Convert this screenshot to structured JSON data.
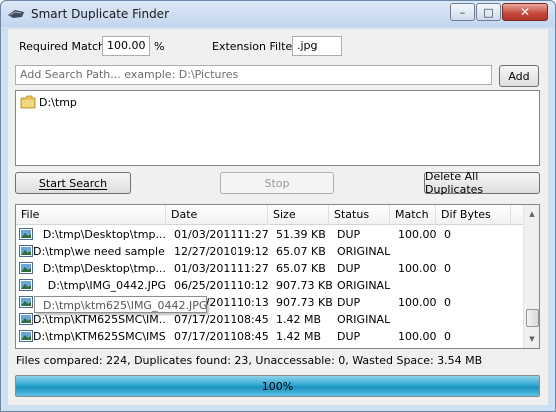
{
  "window": {
    "title": "Smart Duplicate Finder",
    "minimize_glyph": "–",
    "maximize_glyph": "□",
    "close_glyph": "✕"
  },
  "options": {
    "required_match_label": "Required Match:",
    "required_match_value": "100.00",
    "required_match_unit": "%",
    "extension_filter_label": "Extension Filter:",
    "extension_filter_value": ".jpg"
  },
  "search_path": {
    "placeholder": "Add Search Path... example: D:\\Pictures",
    "add_label": "Add"
  },
  "paths": [
    "D:\\tmp"
  ],
  "actions": {
    "start_search": "Start Search",
    "stop": "Stop",
    "delete_all": "Delete All Duplicates"
  },
  "table": {
    "columns": [
      "File",
      "Date",
      "Size",
      "Status",
      "Match",
      "Dif Bytes"
    ],
    "rows": [
      {
        "file": "D:\\tmp\\Desktop\\tmp...",
        "date": "01/03/2011",
        "time": "11:27",
        "size": "51.39 KB",
        "status": "DUP",
        "match": "100.00",
        "dif": "0"
      },
      {
        "file": "D:\\tmp\\we need sample...",
        "date": "12/27/2010",
        "time": "19:12",
        "size": "65.07 KB",
        "status": "ORIGINAL",
        "match": "",
        "dif": ""
      },
      {
        "file": "D:\\tmp\\Desktop\\tmp...",
        "date": "01/03/2011",
        "time": "11:27",
        "size": "65.07 KB",
        "status": "DUP",
        "match": "100.00",
        "dif": "0"
      },
      {
        "file": "D:\\tmp\\IMG_0442.JPG",
        "date": "06/25/2011",
        "time": "10:12",
        "size": "907.73 KB",
        "status": "ORIGINAL",
        "match": "",
        "dif": ""
      },
      {
        "file": "D:\\tmp\\ktm625\\IMG_0442.JPG",
        "date": "06/25/2011",
        "time": "10:13",
        "size": "907.73 KB",
        "status": "DUP",
        "match": "100.00",
        "dif": "0"
      },
      {
        "file": "D:\\tmp\\KTM625SMC\\IM...",
        "date": "07/17/2011",
        "time": "08:45",
        "size": "1.42 MB",
        "status": "ORIGINAL",
        "match": "",
        "dif": ""
      },
      {
        "file": "D:\\tmp\\KTM625SMC\\IMS...",
        "date": "07/17/2011",
        "time": "08:45",
        "size": "1.42 MB",
        "status": "DUP",
        "match": "100.00",
        "dif": "0"
      }
    ],
    "tooltip": "D:\\tmp\\ktm625\\IMG_0442.JPG"
  },
  "status": {
    "summary": "Files compared: 224, Duplicates found: 23, Unaccessable: 0, Wasted Space: 3.54 MB"
  },
  "progress": {
    "percent": 100,
    "label": "100%"
  },
  "colors": {
    "progress_fill": "#30a8d4",
    "close_button": "#c4473a"
  },
  "icons": [
    "app-icon",
    "minimize-icon",
    "maximize-icon",
    "close-icon",
    "folder-icon",
    "image-file-icon",
    "scroll-up-icon",
    "scroll-down-icon"
  ]
}
